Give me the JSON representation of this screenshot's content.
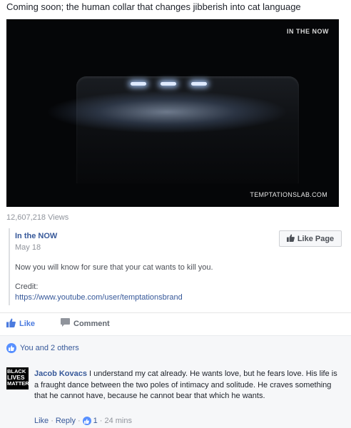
{
  "headline": "Coming soon; the human collar that changes jibberish into cat language",
  "video": {
    "badge": "IN THE NOW",
    "watermark": "TEMPTATIONSLAB.COM"
  },
  "views": "12,607,218 Views",
  "shared_post": {
    "page_name": "In the NOW",
    "date": "May 18",
    "like_page_label": "Like Page",
    "text": "Now you will know for sure that your cat wants to kill you.",
    "credit_label": "Credit:",
    "credit_link": "https://www.youtube.com/user/temptationsbrand"
  },
  "actions": {
    "like_label": "Like",
    "comment_label": "Comment"
  },
  "reactions": {
    "summary": "You and 2 others"
  },
  "comment": {
    "avatar_lines": [
      "BLACK",
      "LIVES",
      "MATTER"
    ],
    "author": "Jacob Kovacs",
    "text": " I understand my cat already. He wants love, but he fears love. His life is a fraught dance between the two poles of intimacy and solitude. He craves something that he cannot have, because he cannot bear that which he wants.",
    "like_label": "Like",
    "reply_label": "Reply",
    "like_count": "1",
    "time": "24 mins",
    "separator": "·"
  },
  "colors": {
    "link": "#365899",
    "like_blue": "#4b7bdf",
    "reaction_blue": "#5890ff",
    "muted": "#90949c"
  }
}
